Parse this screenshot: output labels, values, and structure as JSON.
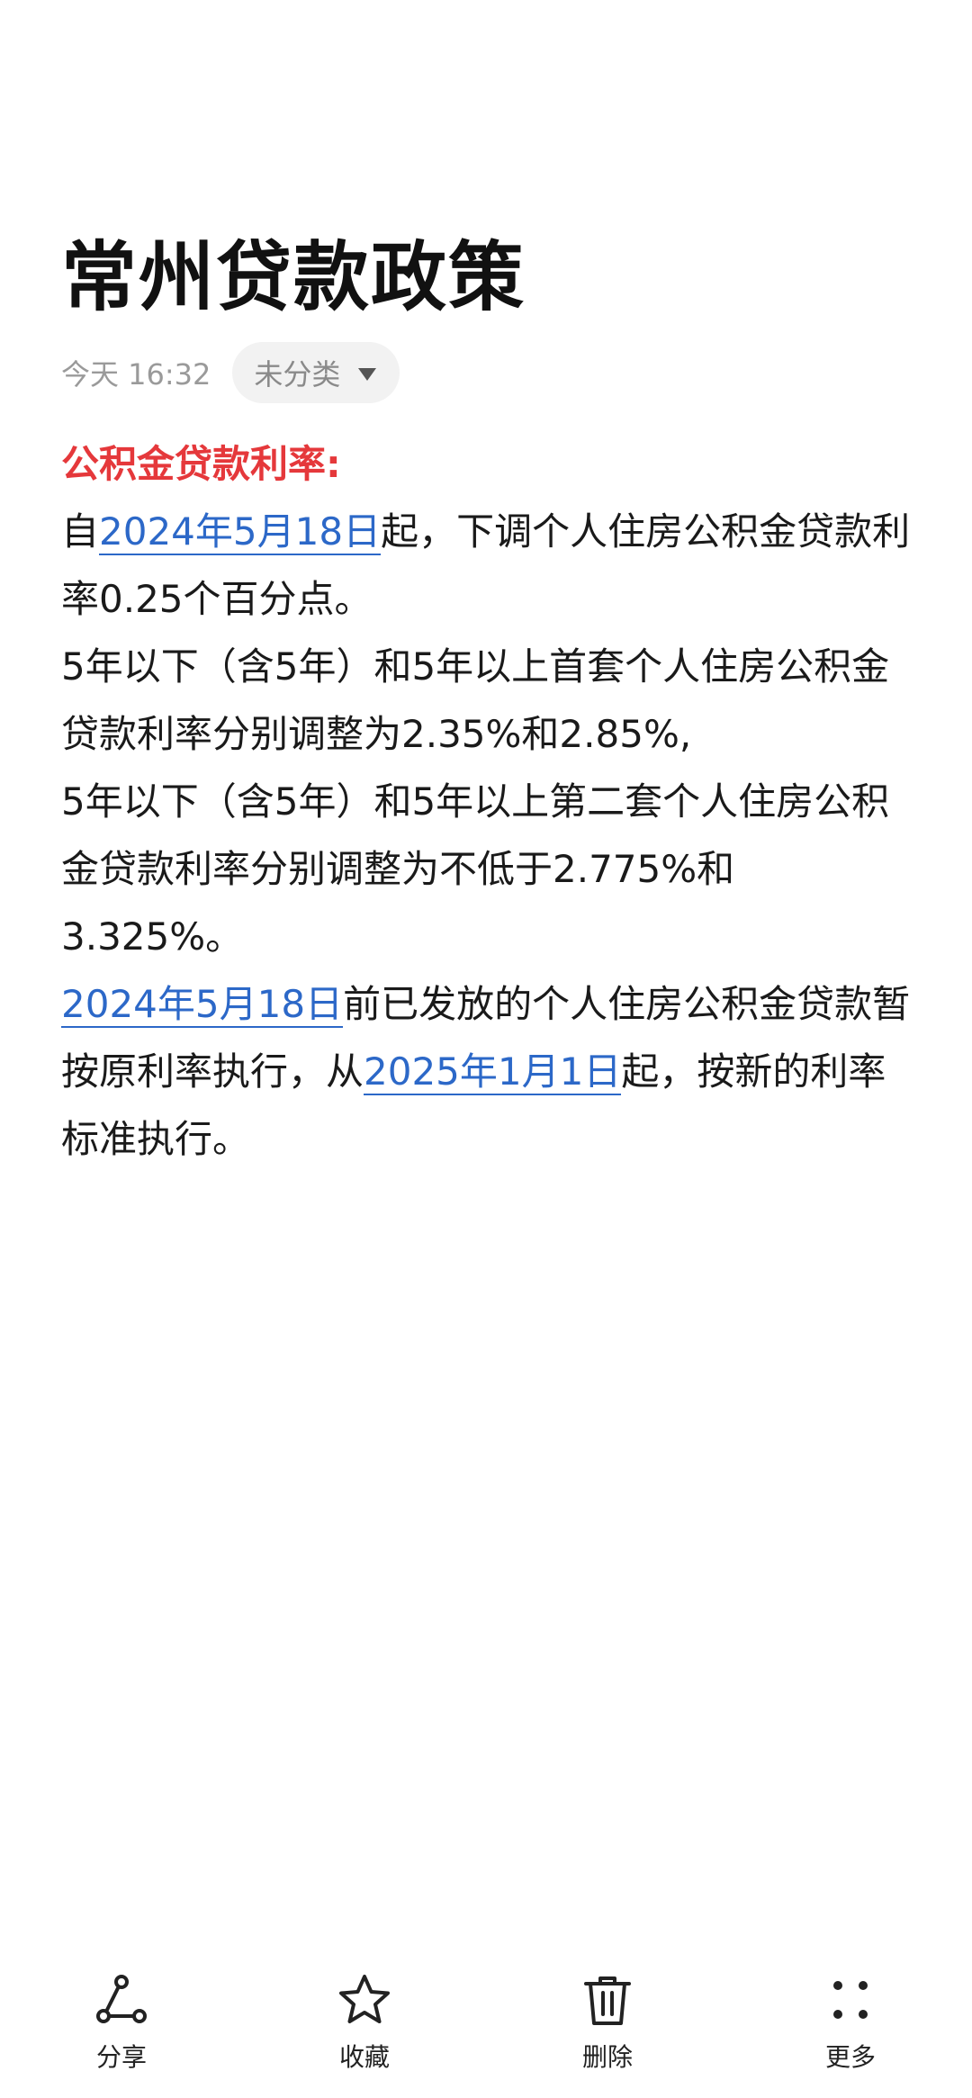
{
  "note": {
    "title": "常州贷款政策",
    "time": "今天 16:32",
    "category": "未分类"
  },
  "body": {
    "heading": "公积金贷款利率:",
    "para1": {
      "prefix": "自",
      "link": "2024年5月18日",
      "suffix": "起，下调个人住房公积金贷款利率0.25个百分点。"
    },
    "para2": "5年以下（含5年）和5年以上首套个人住房公积金贷款利率分别调整为2.35%和2.85%,",
    "para3": "5年以下（含5年）和5年以上第二套个人住房公积金贷款利率分别调整为不低于2.775%和3.325%。",
    "para4": {
      "link1": "2024年5月18日",
      "text1": "前已发放的个人住房公积金贷款暂按原利率执行，从",
      "link2": "2025年1月1日",
      "text2": "起，按新的利率标准执行。"
    }
  },
  "actions": {
    "share": "分享",
    "favorite": "收藏",
    "delete": "删除",
    "more": "更多"
  }
}
